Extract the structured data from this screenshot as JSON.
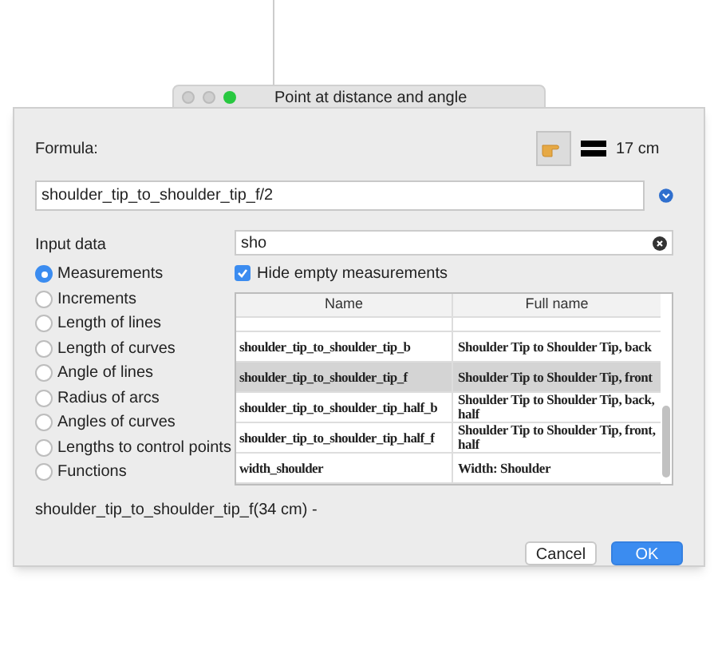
{
  "window": {
    "title": "Point at distance and angle"
  },
  "formula": {
    "label": "Formula:",
    "result": "17 cm",
    "value": "shoulder_tip_to_shoulder_tip_f/2"
  },
  "input_data": {
    "label": "Input data",
    "options": [
      {
        "label": "Measurements",
        "selected": true
      },
      {
        "label": "Increments",
        "selected": false
      },
      {
        "label": "Length of lines",
        "selected": false
      },
      {
        "label": "Length of curves",
        "selected": false
      },
      {
        "label": "Angle of lines",
        "selected": false
      },
      {
        "label": "Radius of arcs",
        "selected": false
      },
      {
        "label": "Angles of curves",
        "selected": false
      },
      {
        "label": "Lengths to control points",
        "selected": false
      },
      {
        "label": "Functions",
        "selected": false
      }
    ]
  },
  "search": {
    "value": "sho"
  },
  "hide_empty": {
    "label": "Hide empty measurements",
    "checked": true
  },
  "table": {
    "columns": [
      "Name",
      "Full name"
    ],
    "rows": [
      {
        "name": "shoulder_tip_to_shoulder_tip_b",
        "full_name": "Shoulder Tip to Shoulder Tip, back",
        "selected": false
      },
      {
        "name": "shoulder_tip_to_shoulder_tip_f",
        "full_name": "Shoulder Tip to Shoulder Tip, front",
        "selected": true
      },
      {
        "name": "shoulder_tip_to_shoulder_tip_half_b",
        "full_name": "Shoulder Tip to Shoulder Tip, back, half",
        "selected": false
      },
      {
        "name": "shoulder_tip_to_shoulder_tip_half_f",
        "full_name": "Shoulder Tip to Shoulder Tip, front, half",
        "selected": false
      },
      {
        "name": "width_shoulder",
        "full_name": "Width: Shoulder",
        "selected": false
      }
    ]
  },
  "status": "shoulder_tip_to_shoulder_tip_f(34 cm) -",
  "buttons": [
    {
      "label": "Cancel",
      "kind": "secondary"
    },
    {
      "label": "OK",
      "kind": "primary"
    }
  ]
}
